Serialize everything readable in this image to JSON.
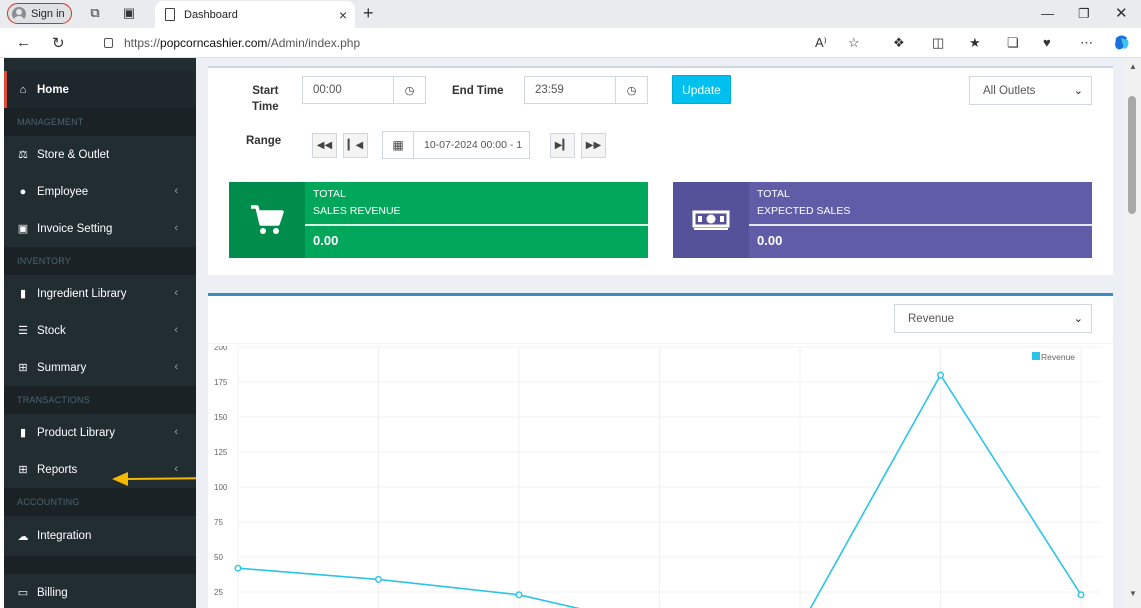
{
  "browser": {
    "signin_label": "Sign in",
    "tab_title": "Dashboard",
    "url_prefix": "https://",
    "url_host": "popcorncashier.com",
    "url_path": "/Admin/index.php",
    "read_aloud_label": "A⁾"
  },
  "sidebar": {
    "home": "Home",
    "sections": {
      "management": "MANAGEMENT",
      "inventory": "INVENTORY",
      "transactions": "TRANSACTIONS",
      "accounting": "ACCOUNTING"
    },
    "items": {
      "store_outlet": "Store & Outlet",
      "employee": "Employee",
      "invoice_setting": "Invoice Setting",
      "ingredient_library": "Ingredient Library",
      "stock": "Stock",
      "summary": "Summary",
      "product_library": "Product Library",
      "reports": "Reports",
      "integration": "Integration",
      "billing": "Billing"
    }
  },
  "filters": {
    "start_time_label_1": "Start",
    "start_time_label_2": "Time",
    "start_time_value": "00:00",
    "end_time_label": "End Time",
    "end_time_value": "23:59",
    "update_label": "Update",
    "outlet_selected": "All Outlets",
    "range_label": "Range",
    "range_value": "10-07-2024 00:00 - 1"
  },
  "infoboxes": {
    "revenue": {
      "line1": "TOTAL",
      "line2": "SALES REVENUE",
      "value": "0.00",
      "color": "#00a65a",
      "icon_color": "#008d4c"
    },
    "expected": {
      "line1": "TOTAL",
      "line2": "EXPECTED SALES",
      "value": "0.00",
      "color": "#605ca8",
      "icon_color": "#555299"
    }
  },
  "chart_select": "Revenue",
  "chart_data": {
    "type": "line",
    "series": [
      {
        "name": "Revenue",
        "color": "#2bc4e8",
        "values": [
          42,
          34,
          23,
          0,
          0,
          180,
          23
        ]
      }
    ],
    "y_ticks": [
      25,
      50,
      75,
      100,
      125,
      150,
      175,
      200
    ],
    "ylim": [
      0,
      200
    ],
    "grid": true,
    "legend": "top-right"
  },
  "annotation": {
    "arrow_color": "#f5b800",
    "target": "Reports"
  }
}
